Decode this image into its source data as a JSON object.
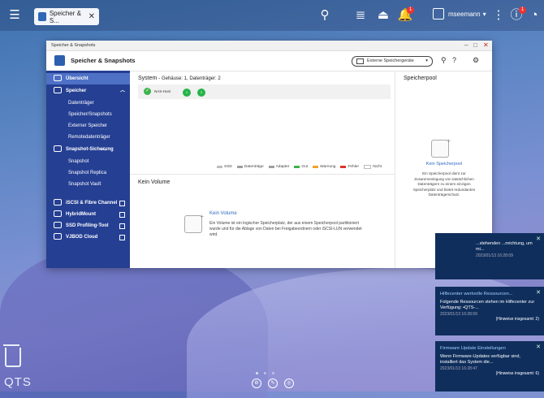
{
  "desktop": {
    "brand": "QTS",
    "page_dots": 3
  },
  "topbar": {
    "app_tab_label": "Speicher & S...",
    "username": "mseemann",
    "notification_badge": "1",
    "info_badge": "1"
  },
  "window": {
    "title": "Speicher & Snapshots",
    "app_name": "Speicher & Snapshots",
    "external_button": "Externe Speichergeräte",
    "external_button_caret": "▾"
  },
  "sidebar": {
    "overview": "Übersicht",
    "storage": "Speicher",
    "storage_items": [
      "Datenträger",
      "Speicher/Snapshots",
      "Externer Speicher",
      "Remotedatenträger"
    ],
    "snapshot_backup": "Snapshot-Sicherung",
    "snapshot_items": [
      "Snapshot",
      "Snapshot Replica",
      "Snapshot Vault"
    ],
    "tools": [
      "iSCSI & Fibre Channel",
      "HybridMount",
      "SSD Profiling-Tool",
      "VJBOD Cloud"
    ]
  },
  "system": {
    "title": "System",
    "subtitle": "- Gehäuse: 1, Datenträger: 2",
    "host_label": "NAS-Host",
    "bays": [
      "1",
      "2"
    ]
  },
  "legend": [
    {
      "label": "SSD",
      "color": "#bdbdbd"
    },
    {
      "label": "Datenträge",
      "color": "#9e9e9e"
    },
    {
      "label": "Adapter",
      "color": "#9e9e9e"
    },
    {
      "label": "Gut",
      "color": "#3db34a"
    },
    {
      "label": "Warnung",
      "color": "#f0a12e"
    },
    {
      "label": "Fehler",
      "color": "#d9342b"
    },
    {
      "label": "Nicht",
      "color": "#ffffff"
    }
  ],
  "volume": {
    "title": "Kein Volume",
    "empty_title": "Kein Volume",
    "empty_desc": "Ein Volume ist ein logischer Speicherplatz, der aus einem Speicherpool partitioniert wurde und für die Ablage von Daten bei Freigabeordnern oder iSCSI-LUN verwendet wird."
  },
  "pool": {
    "title": "Speicherpool",
    "empty_title": "Kein Speicherpool",
    "empty_desc": "Ein Speicherpool dient zur Zusammenlegung von tatsächlichen Datenträgern zu einem einzigen Speicherplatz und bietet redundanten Datenträgerschutz."
  },
  "notifications": [
    {
      "header": "",
      "body": "...stehenden ...nrichtung, um mi...",
      "time": "2023/01/13 16:28:09",
      "count": ""
    },
    {
      "header": "Hilfecenter wertvolle Ressourcen...",
      "body": "Folgende Ressourcen stehen im Hilfecenter zur Verfügung: •QTS-...",
      "time": "2023/01/13 16:28:09",
      "count": "(Hinweise insgesamt: 2)"
    },
    {
      "header": "Firmware Update Einstellungen",
      "body": "Wenn Firmware-Updates verfügbar sind, installiert das System die...",
      "time": "2023/01/13 16:28:47",
      "count": "(Hinweise insgesamt: 6)"
    }
  ],
  "colors": {
    "sidebar": "#253f93",
    "sidebar_active": "#4e71c6",
    "link": "#2f6bc0",
    "ok_green": "#3db34a"
  }
}
